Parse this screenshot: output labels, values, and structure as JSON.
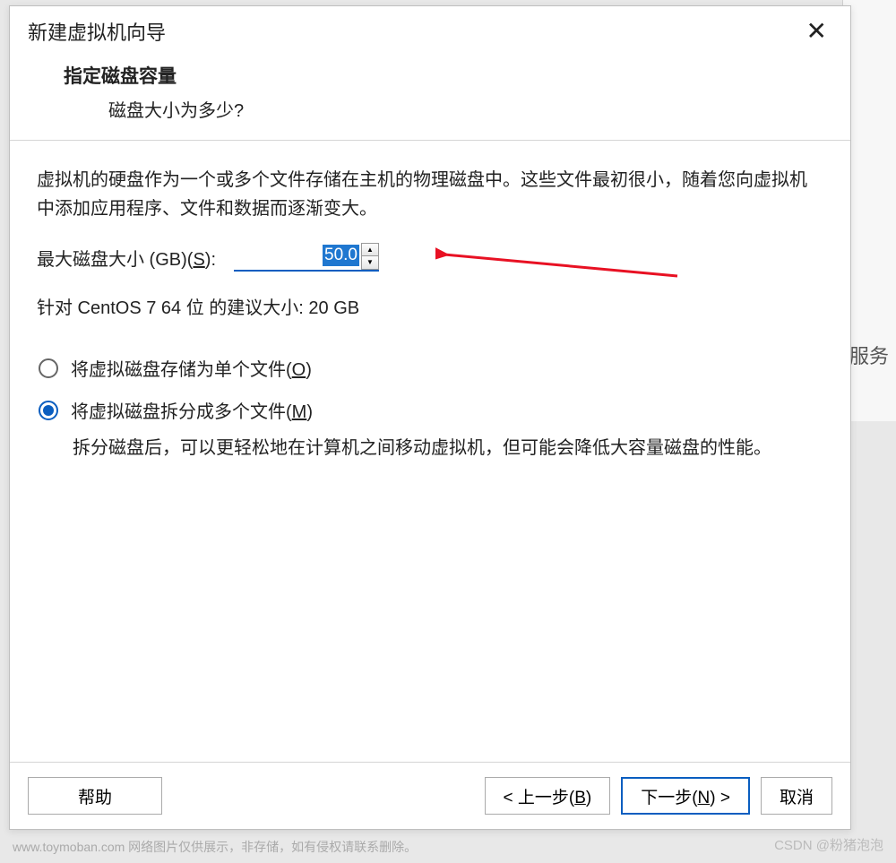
{
  "backdrop": {
    "partial_text": "服务"
  },
  "dialog": {
    "title": "新建虚拟机向导",
    "close_label": "✕",
    "header": {
      "title": "指定磁盘容量",
      "subtitle": "磁盘大小为多少?"
    },
    "description": "虚拟机的硬盘作为一个或多个文件存储在主机的物理磁盘中。这些文件最初很小，随着您向虚拟机中添加应用程序、文件和数据而逐渐变大。",
    "disk_size": {
      "label_prefix": "最大磁盘大小 (GB)(",
      "label_key": "S",
      "label_suffix": "):",
      "value": "50.0"
    },
    "recommendation": "针对 CentOS 7 64 位 的建议大小: 20 GB",
    "radios": {
      "single": {
        "text_prefix": "将虚拟磁盘存储为单个文件(",
        "key": "O",
        "text_suffix": ")",
        "checked": false
      },
      "split": {
        "text_prefix": "将虚拟磁盘拆分成多个文件(",
        "key": "M",
        "text_suffix": ")",
        "checked": true
      },
      "split_desc": "拆分磁盘后，可以更轻松地在计算机之间移动虚拟机，但可能会降低大容量磁盘的性能。"
    },
    "buttons": {
      "help": "帮助",
      "back_prefix": "< 上一步(",
      "back_key": "B",
      "back_suffix": ")",
      "next_prefix": "下一步(",
      "next_key": "N",
      "next_suffix": ") >",
      "cancel": "取消"
    }
  },
  "watermark": {
    "left": "www.toymoban.com 网络图片仅供展示，非存储，如有侵权请联系删除。",
    "right": "CSDN @粉猪泡泡"
  }
}
